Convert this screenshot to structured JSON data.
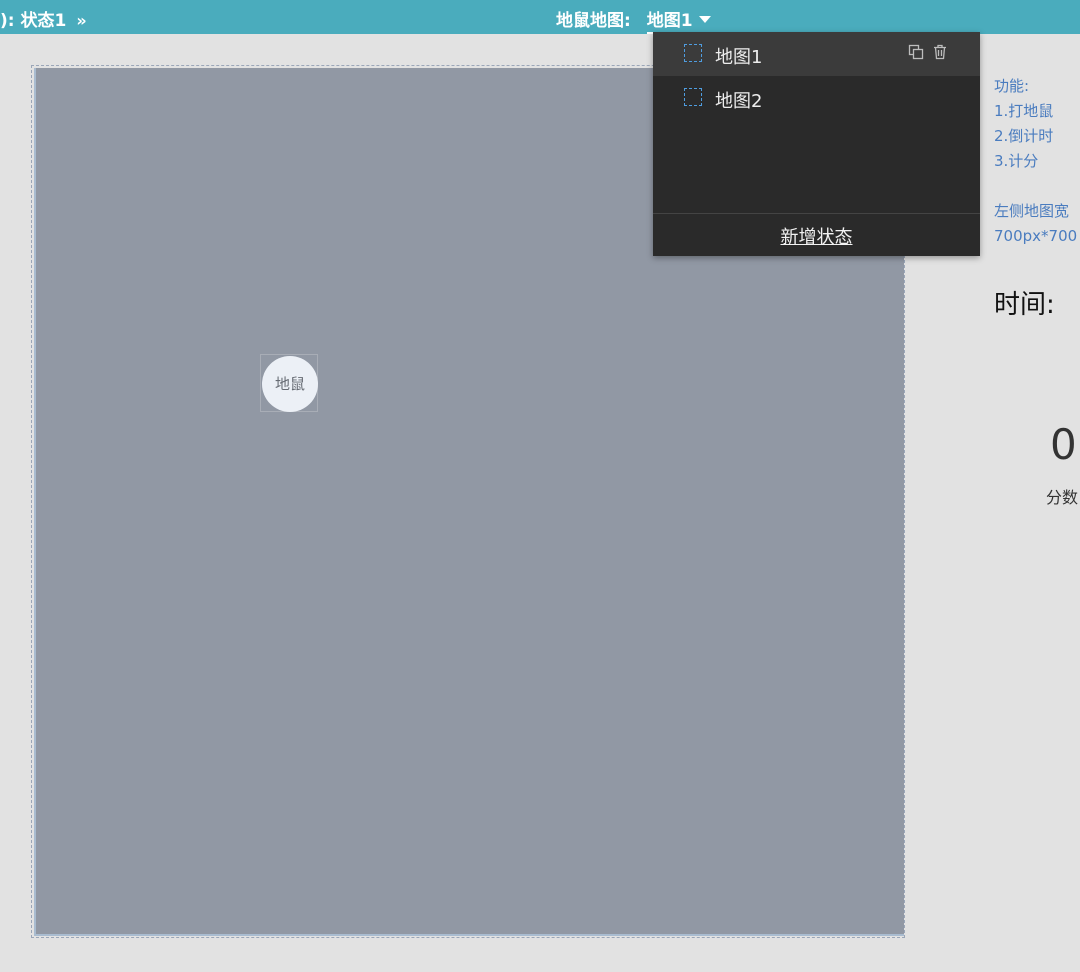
{
  "topbar": {
    "left_label": "): 状态1",
    "left_chevron": "»",
    "center_label": "地鼠地图:",
    "current_state": "地图1"
  },
  "canvas": {
    "mole_label": "地鼠"
  },
  "dropdown": {
    "items": [
      {
        "label": "地图1",
        "active": true
      },
      {
        "label": "地图2",
        "active": false
      }
    ],
    "add_state_label": "新增状态"
  },
  "right_panel": {
    "features_title": "功能:",
    "feature_1": "1.打地鼠",
    "feature_2": "2.倒计时",
    "feature_3": "3.计分",
    "note_line1": "左侧地图宽",
    "note_line2": "700px*700",
    "time_label": "时间:",
    "score_value": "0",
    "score_label": "分数"
  },
  "colors": {
    "topbar": "#4aacbd",
    "canvas": "#9198a4",
    "dropdown_bg": "#2a2a2a",
    "note_text": "#4a7cbf"
  }
}
